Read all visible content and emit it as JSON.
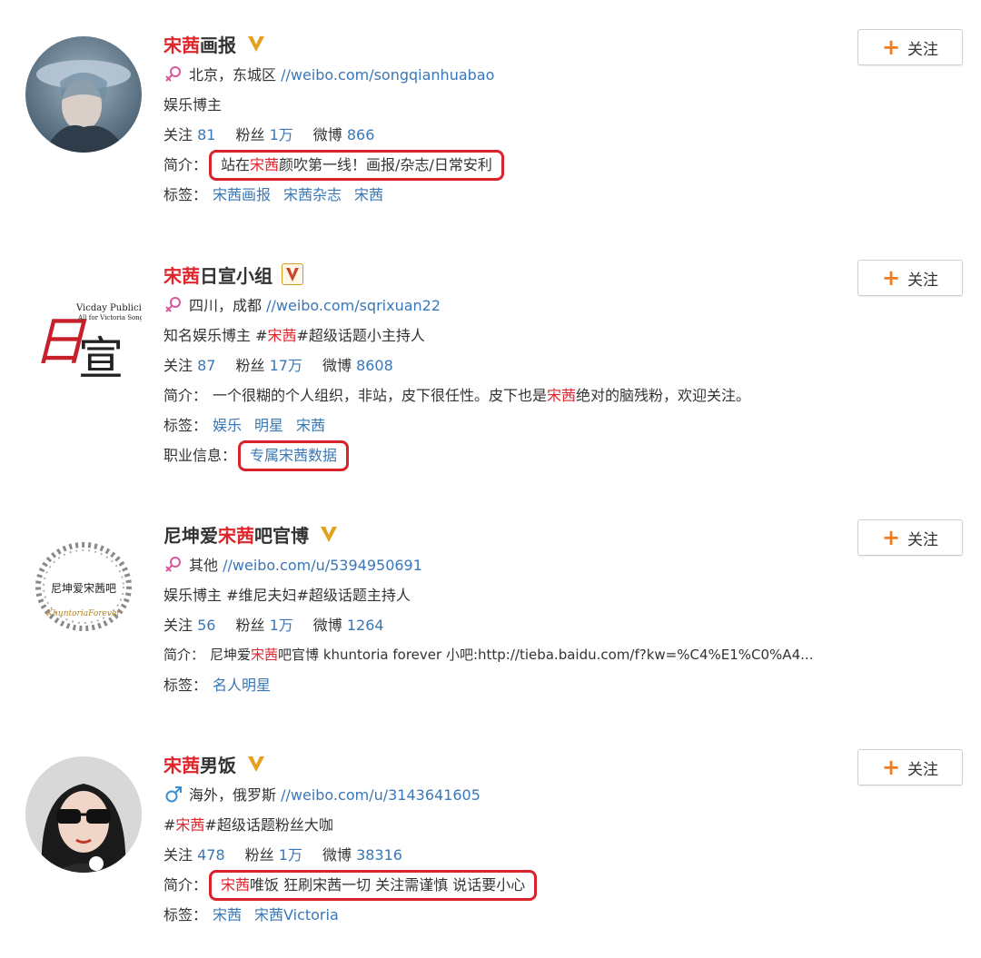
{
  "colors": {
    "highlight": "#e0242c",
    "link": "#3a77b6",
    "follow_plus": "#ef7c1f",
    "annotation_box": "#d8232a",
    "verified_badge": "#e5a11d"
  },
  "labels": {
    "follows": "关注",
    "fans": "粉丝",
    "posts": "微博",
    "intro": "简介：",
    "tags": "标签：",
    "career": "职业信息："
  },
  "follow_button": {
    "plus": "+",
    "label": "关注"
  },
  "users": [
    {
      "name_hl": "宋茜",
      "name_rest": "画报",
      "name_pre": "",
      "badge_icon": "verified-v-icon",
      "gender_icon": "female-icon",
      "location": "北京，东城区",
      "url": "//weibo.com/songqianhuabao",
      "desc_pre": "娱乐博主",
      "desc_hl": "",
      "desc_post": "",
      "follows": "81",
      "fans": "1万",
      "posts": "866",
      "intro_pre": "站在",
      "intro_hl": "宋茜",
      "intro_post": "颜吹第一线！画报/杂志/日常安利",
      "tags": [
        "宋茜画报",
        "宋茜杂志",
        "宋茜"
      ]
    },
    {
      "name_hl": "宋茜",
      "name_rest": "日宣小组",
      "name_pre": "",
      "badge_icon": "verified-v-boxed-icon",
      "gender_icon": "female-icon",
      "location": "四川，成都",
      "url": "//weibo.com/sqrixuan22",
      "desc_pre": "知名娱乐博主 #",
      "desc_hl": "宋茜",
      "desc_post": "#超级话题小主持人",
      "follows": "87",
      "fans": "17万",
      "posts": "8608",
      "intro_pre": "一个很糊的个人组织，非站，皮下很任性。皮下也是",
      "intro_hl": "宋茜",
      "intro_post": "绝对的脑残粉，欢迎关注。",
      "tags": [
        "娱乐",
        "明星",
        "宋茜"
      ],
      "career": "专属宋茜数据",
      "avatar_text": {
        "big": "日宣",
        "line1": "Vicday Publicity",
        "line2": "All for Victoria Song"
      }
    },
    {
      "name_pre": "尼坤爱",
      "name_hl": "宋茜",
      "name_rest": "吧官博",
      "badge_icon": "verified-v-icon",
      "gender_icon": "female-icon",
      "location": "其他",
      "url": "//weibo.com/u/5394950691",
      "desc_pre": "娱乐博主 #维尼夫妇#超级话题主持人",
      "desc_hl": "",
      "desc_post": "",
      "follows": "56",
      "fans": "1万",
      "posts": "1264",
      "intro_pre": "尼坤爱",
      "intro_hl": "宋茜",
      "intro_post": "吧官博 khuntoria forever 小吧:http://tieba.baidu.com/f?kw=%C4%E1%C0%A4...",
      "tags": [
        "名人明星"
      ],
      "avatar_text": {
        "title": "尼坤爱宋茜吧",
        "sub": "KhuntoriaForever"
      }
    },
    {
      "name_hl": "宋茜",
      "name_rest": "男饭",
      "name_pre": "",
      "badge_icon": "verified-v-icon",
      "gender_icon": "male-icon",
      "location": "海外，俄罗斯",
      "url": "//weibo.com/u/3143641605",
      "desc_pre": "#",
      "desc_hl": "宋茜",
      "desc_post": "#超级话题粉丝大咖",
      "follows": "478",
      "fans": "1万",
      "posts": "38316",
      "intro_pre": "",
      "intro_hl": "宋茜",
      "intro_post": "唯饭 狂刷宋茜一切 关注需谨慎 说话要小心",
      "tags": [
        "宋茜",
        "宋茜Victoria"
      ]
    }
  ]
}
